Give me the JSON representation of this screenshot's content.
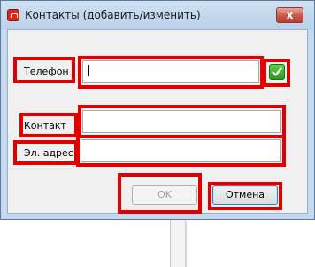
{
  "window": {
    "title": "Контакты (добавить/изменить)",
    "close_glyph": "x"
  },
  "form": {
    "phone_label": "Телефон",
    "phone_value": "",
    "contact_label": "Контакт",
    "contact_value": "",
    "email_label": "Эл. адрес",
    "email_value": ""
  },
  "buttons": {
    "ok_label": "OK",
    "cancel_label": "Отмена"
  },
  "icons": {
    "app": "phone-app-icon",
    "confirm": "checkmark-icon",
    "close": "close-icon"
  },
  "colors": {
    "highlight": "#e00000",
    "confirm_green": "#2c9a25"
  }
}
